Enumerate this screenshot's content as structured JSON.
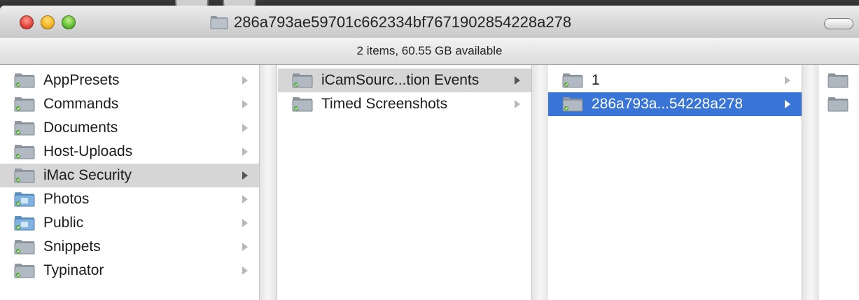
{
  "window": {
    "title": "286a793ae59701c662334bf7671902854228a278",
    "status": "2 items, 60.55 GB available"
  },
  "columns": [
    {
      "items": [
        {
          "label": "AppPresets",
          "icon": "folder-icon",
          "selected": "none"
        },
        {
          "label": "Commands",
          "icon": "folder-icon",
          "selected": "none"
        },
        {
          "label": "Documents",
          "icon": "folder-icon",
          "selected": "none"
        },
        {
          "label": "Host-Uploads",
          "icon": "folder-icon",
          "selected": "none"
        },
        {
          "label": "iMac Security",
          "icon": "folder-icon",
          "selected": "grey"
        },
        {
          "label": "Photos",
          "icon": "photos-folder-icon",
          "selected": "none"
        },
        {
          "label": "Public",
          "icon": "public-folder-icon",
          "selected": "none"
        },
        {
          "label": "Snippets",
          "icon": "folder-icon",
          "selected": "none"
        },
        {
          "label": "Typinator",
          "icon": "folder-icon",
          "selected": "none"
        }
      ]
    },
    {
      "items": [
        {
          "label": "iCamSourc...tion Events",
          "icon": "folder-icon",
          "selected": "grey"
        },
        {
          "label": "Timed Screenshots",
          "icon": "folder-icon",
          "selected": "none"
        }
      ]
    },
    {
      "items": [
        {
          "label": "1",
          "icon": "folder-icon",
          "selected": "none"
        },
        {
          "label": "286a793a...54228a278",
          "icon": "folder-icon",
          "selected": "blue"
        }
      ]
    }
  ],
  "colors": {
    "selection_blue": "#3875d7",
    "selection_grey": "#d6d6d6",
    "folder_grey": "#a9b2ba",
    "folder_blue": "#6ea6d8"
  }
}
